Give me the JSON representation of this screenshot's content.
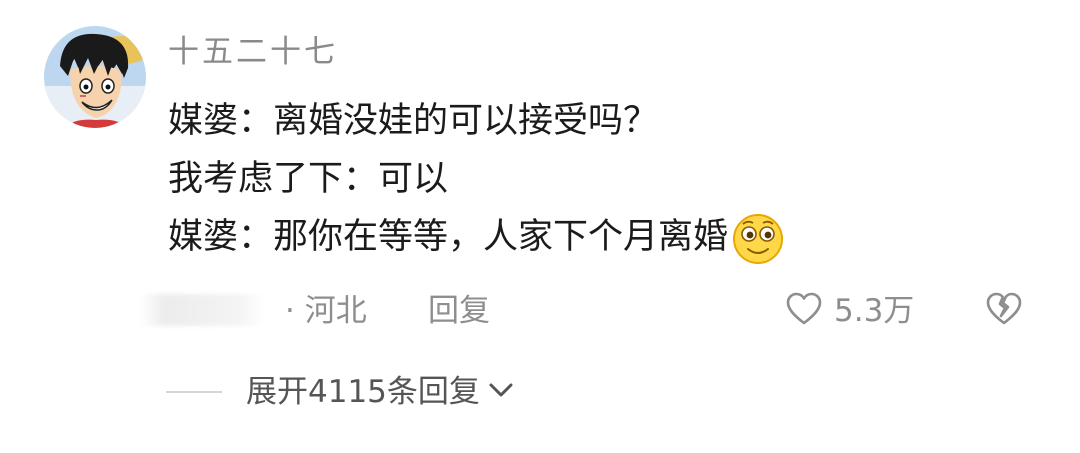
{
  "comment": {
    "username": "十五二十七",
    "lines": [
      "媒婆：离婚没娃的可以接受吗？",
      "我考虑了下：可以",
      "媒婆：那你在等等，人家下个月离婚"
    ],
    "emoji": "smile-emoji",
    "meta": {
      "location": "· 河北",
      "reply_label": "回复"
    },
    "likes": "5.3万",
    "expand_label": "展开4115条回复"
  },
  "colors": {
    "text": "#1b1b1b",
    "muted": "#8e8e8e",
    "expand_text": "#555555"
  },
  "icons": [
    "avatar-luffy",
    "smile-emoji-icon",
    "heart-outline-icon",
    "broken-heart-icon",
    "chevron-down-icon"
  ]
}
